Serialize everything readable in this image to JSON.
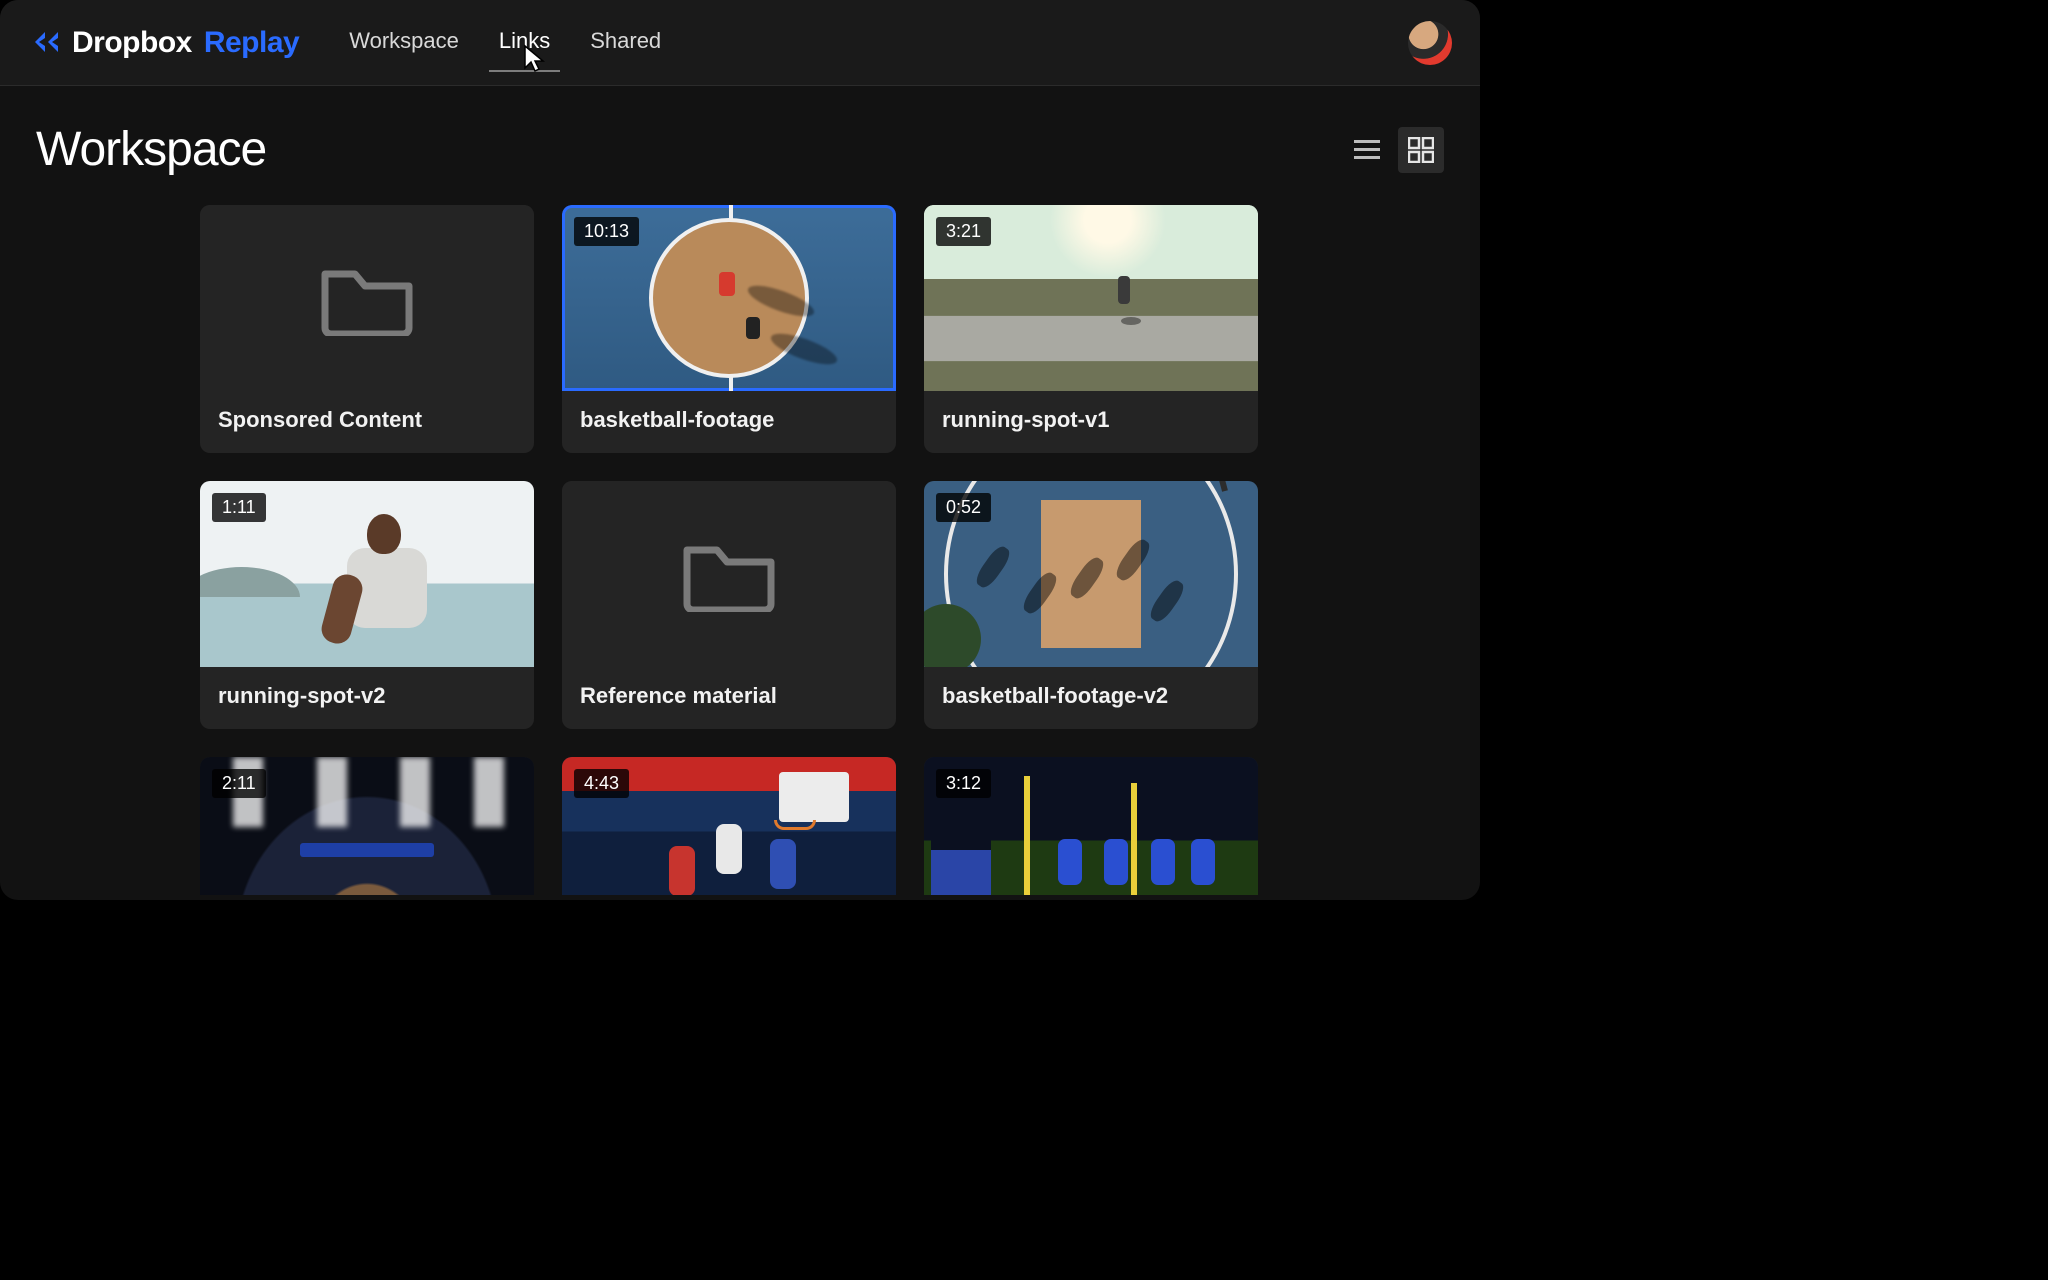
{
  "brand": {
    "name": "Dropbox",
    "product": "Replay"
  },
  "nav": {
    "items": [
      {
        "label": "Workspace",
        "hovered": false
      },
      {
        "label": "Links",
        "hovered": true
      },
      {
        "label": "Shared",
        "hovered": false
      }
    ]
  },
  "page": {
    "title": "Workspace"
  },
  "view": {
    "mode": "grid"
  },
  "items": [
    {
      "kind": "folder",
      "title": "Sponsored Content"
    },
    {
      "kind": "video",
      "title": "basketball-footage",
      "duration": "10:13",
      "art": "court",
      "selected": true
    },
    {
      "kind": "video",
      "title": "running-spot-v1",
      "duration": "3:21",
      "art": "road"
    },
    {
      "kind": "video",
      "title": "running-spot-v2",
      "duration": "1:11",
      "art": "beach"
    },
    {
      "kind": "folder",
      "title": "Reference material"
    },
    {
      "kind": "video",
      "title": "basketball-footage-v2",
      "duration": "0:52",
      "art": "aerial"
    },
    {
      "kind": "video",
      "title": "",
      "duration": "2:11",
      "art": "arena"
    },
    {
      "kind": "video",
      "title": "",
      "duration": "4:43",
      "art": "dunk"
    },
    {
      "kind": "video",
      "title": "",
      "duration": "3:12",
      "art": "soccer"
    }
  ]
}
